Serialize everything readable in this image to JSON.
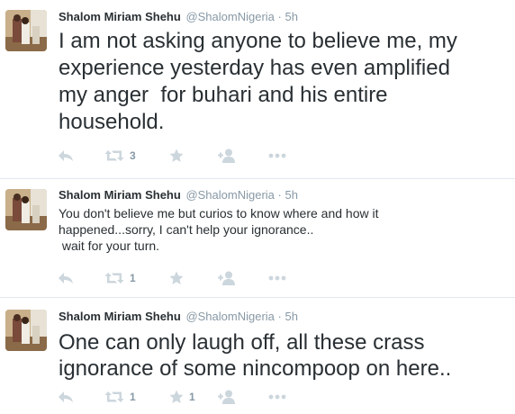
{
  "colors": {
    "icon": "#ccd6dd",
    "meta": "#8899a6",
    "text": "#292f33",
    "divider": "#e1e8ed"
  },
  "icons": {
    "reply": "reply-icon",
    "retweet": "retweet-icon",
    "favorite": "star-icon",
    "follow": "follow-user-icon",
    "more": "more-dots-icon"
  },
  "tweets": [
    {
      "fullname": "Shalom Miriam Shehu",
      "handle": "@ShalomNigeria",
      "separator": "·",
      "time": "5h",
      "lines": [
        "I am not asking anyone to believe me, my",
        "experience yesterday has even amplified",
        "my anger  for buhari and his entire",
        "household."
      ],
      "retweets": "3",
      "favorites": ""
    },
    {
      "fullname": "Shalom Miriam Shehu",
      "handle": "@ShalomNigeria",
      "separator": "·",
      "time": "5h",
      "lines": [
        "You don't believe me but curios to know where and how it",
        "happened...sorry, I can't help your ignorance..",
        " wait for your turn."
      ],
      "retweets": "1",
      "favorites": ""
    },
    {
      "fullname": "Shalom Miriam Shehu",
      "handle": "@ShalomNigeria",
      "separator": "·",
      "time": "5h",
      "lines": [
        "One can only laugh off, all these crass",
        "ignorance of some nincompoop on here.."
      ],
      "retweets": "1",
      "favorites": "1"
    }
  ]
}
